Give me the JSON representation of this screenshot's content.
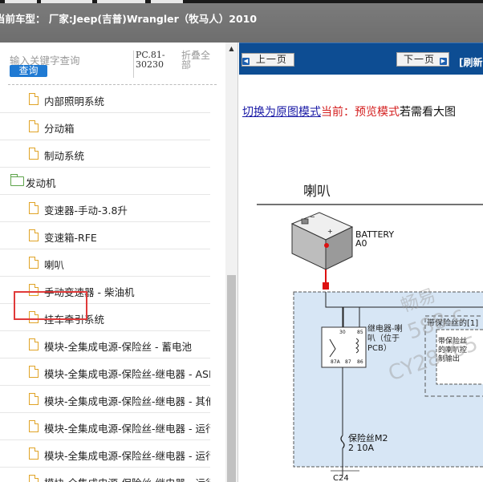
{
  "header": {
    "model_line": "当前车型： 厂家:Jeep(吉普)Wrangler（牧马人）2010"
  },
  "search": {
    "placeholder": "输入关键字查询",
    "query_button": "查询",
    "pc_code": "PC.81-30230",
    "fold_all": "折叠全部"
  },
  "tree": {
    "items": [
      {
        "label": "内部照明系统",
        "type": "doc"
      },
      {
        "label": "分动箱",
        "type": "doc"
      },
      {
        "label": "制动系统",
        "type": "doc"
      },
      {
        "label": "发动机",
        "type": "folder"
      },
      {
        "label": "变速器-手动-3.8升",
        "type": "doc"
      },
      {
        "label": "变速箱-RFE",
        "type": "doc"
      },
      {
        "label": "喇叭",
        "type": "doc",
        "selected": true
      },
      {
        "label": "手动变速器 - 柴油机",
        "type": "doc"
      },
      {
        "label": "挂车牵引系统",
        "type": "doc"
      },
      {
        "label": "模块-全集成电源-保险丝 - 蓄电池",
        "type": "doc"
      },
      {
        "label": "模块-全集成电源-保险丝-继电器 - ASD - 保",
        "type": "doc"
      },
      {
        "label": "模块-全集成电源-保险丝-继电器 - 其他",
        "type": "doc"
      },
      {
        "label": "模块-全集成电源-保险丝-继电器 - 运行",
        "type": "doc"
      },
      {
        "label": "模块-全集成电源-保险丝-继电器 - 运行-起",
        "type": "doc"
      },
      {
        "label": "模块-全集成电源-保险丝-继电器 - 运行-时",
        "type": "doc"
      }
    ]
  },
  "viewer": {
    "prev_label": "上一页",
    "next_label": "下一页",
    "refresh_label": "[刷新",
    "switch_link": "切换为原图模式",
    "current_mode": "当前：预览模式",
    "hint": "若需看大图",
    "diagram": {
      "title": "喇叭",
      "battery_name": "BATTERY",
      "battery_code": "A0",
      "relay_label": "继电器-喇叭（位于PCB）",
      "relay_pins": [
        "30",
        "85",
        "87A",
        "87",
        "86"
      ],
      "fuse_note": "带保险丝的[1]",
      "horn_control": "带保险丝的喇叭控制输出",
      "fuse_label": "保险丝M2",
      "fuse_rating": "2 10A",
      "connector": "C24",
      "watermark_1": "畅易",
      "watermark_2": "588.c",
      "watermark_3": "CY28165"
    }
  },
  "colors": {
    "toolbar_blue": "#0d4d93",
    "query_blue": "#1f7ad3",
    "highlight_red": "#e03a3a",
    "folder_green": "#5ea44b",
    "doc_orange": "#e0a326",
    "diagram_fill": "#d7e6f5"
  }
}
